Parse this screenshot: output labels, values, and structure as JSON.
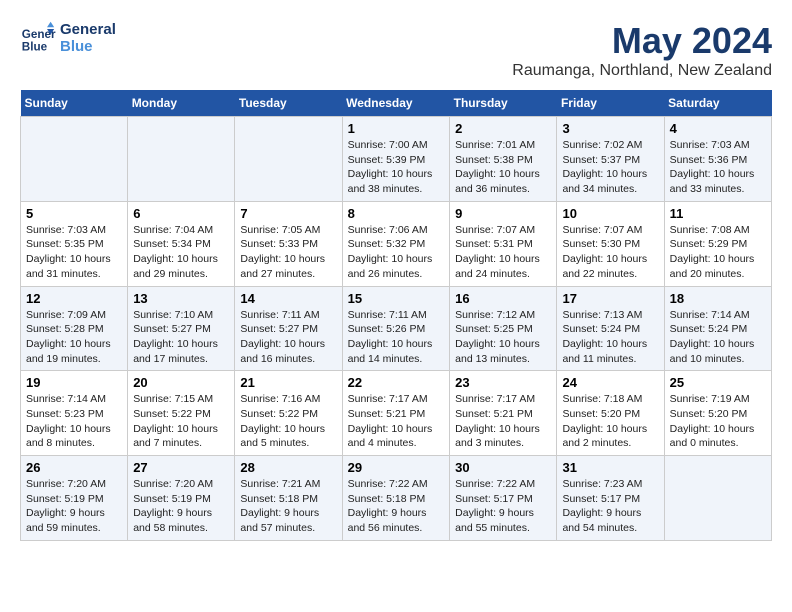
{
  "header": {
    "logo_line1": "General",
    "logo_line2": "Blue",
    "title": "May 2024",
    "subtitle": "Raumanga, Northland, New Zealand"
  },
  "days_of_week": [
    "Sunday",
    "Monday",
    "Tuesday",
    "Wednesday",
    "Thursday",
    "Friday",
    "Saturday"
  ],
  "weeks": [
    {
      "row_class": "alt-row",
      "days": [
        {
          "number": "",
          "info": ""
        },
        {
          "number": "",
          "info": ""
        },
        {
          "number": "",
          "info": ""
        },
        {
          "number": "1",
          "info": "Sunrise: 7:00 AM\nSunset: 5:39 PM\nDaylight: 10 hours\nand 38 minutes."
        },
        {
          "number": "2",
          "info": "Sunrise: 7:01 AM\nSunset: 5:38 PM\nDaylight: 10 hours\nand 36 minutes."
        },
        {
          "number": "3",
          "info": "Sunrise: 7:02 AM\nSunset: 5:37 PM\nDaylight: 10 hours\nand 34 minutes."
        },
        {
          "number": "4",
          "info": "Sunrise: 7:03 AM\nSunset: 5:36 PM\nDaylight: 10 hours\nand 33 minutes."
        }
      ]
    },
    {
      "row_class": "",
      "days": [
        {
          "number": "5",
          "info": "Sunrise: 7:03 AM\nSunset: 5:35 PM\nDaylight: 10 hours\nand 31 minutes."
        },
        {
          "number": "6",
          "info": "Sunrise: 7:04 AM\nSunset: 5:34 PM\nDaylight: 10 hours\nand 29 minutes."
        },
        {
          "number": "7",
          "info": "Sunrise: 7:05 AM\nSunset: 5:33 PM\nDaylight: 10 hours\nand 27 minutes."
        },
        {
          "number": "8",
          "info": "Sunrise: 7:06 AM\nSunset: 5:32 PM\nDaylight: 10 hours\nand 26 minutes."
        },
        {
          "number": "9",
          "info": "Sunrise: 7:07 AM\nSunset: 5:31 PM\nDaylight: 10 hours\nand 24 minutes."
        },
        {
          "number": "10",
          "info": "Sunrise: 7:07 AM\nSunset: 5:30 PM\nDaylight: 10 hours\nand 22 minutes."
        },
        {
          "number": "11",
          "info": "Sunrise: 7:08 AM\nSunset: 5:29 PM\nDaylight: 10 hours\nand 20 minutes."
        }
      ]
    },
    {
      "row_class": "alt-row",
      "days": [
        {
          "number": "12",
          "info": "Sunrise: 7:09 AM\nSunset: 5:28 PM\nDaylight: 10 hours\nand 19 minutes."
        },
        {
          "number": "13",
          "info": "Sunrise: 7:10 AM\nSunset: 5:27 PM\nDaylight: 10 hours\nand 17 minutes."
        },
        {
          "number": "14",
          "info": "Sunrise: 7:11 AM\nSunset: 5:27 PM\nDaylight: 10 hours\nand 16 minutes."
        },
        {
          "number": "15",
          "info": "Sunrise: 7:11 AM\nSunset: 5:26 PM\nDaylight: 10 hours\nand 14 minutes."
        },
        {
          "number": "16",
          "info": "Sunrise: 7:12 AM\nSunset: 5:25 PM\nDaylight: 10 hours\nand 13 minutes."
        },
        {
          "number": "17",
          "info": "Sunrise: 7:13 AM\nSunset: 5:24 PM\nDaylight: 10 hours\nand 11 minutes."
        },
        {
          "number": "18",
          "info": "Sunrise: 7:14 AM\nSunset: 5:24 PM\nDaylight: 10 hours\nand 10 minutes."
        }
      ]
    },
    {
      "row_class": "",
      "days": [
        {
          "number": "19",
          "info": "Sunrise: 7:14 AM\nSunset: 5:23 PM\nDaylight: 10 hours\nand 8 minutes."
        },
        {
          "number": "20",
          "info": "Sunrise: 7:15 AM\nSunset: 5:22 PM\nDaylight: 10 hours\nand 7 minutes."
        },
        {
          "number": "21",
          "info": "Sunrise: 7:16 AM\nSunset: 5:22 PM\nDaylight: 10 hours\nand 5 minutes."
        },
        {
          "number": "22",
          "info": "Sunrise: 7:17 AM\nSunset: 5:21 PM\nDaylight: 10 hours\nand 4 minutes."
        },
        {
          "number": "23",
          "info": "Sunrise: 7:17 AM\nSunset: 5:21 PM\nDaylight: 10 hours\nand 3 minutes."
        },
        {
          "number": "24",
          "info": "Sunrise: 7:18 AM\nSunset: 5:20 PM\nDaylight: 10 hours\nand 2 minutes."
        },
        {
          "number": "25",
          "info": "Sunrise: 7:19 AM\nSunset: 5:20 PM\nDaylight: 10 hours\nand 0 minutes."
        }
      ]
    },
    {
      "row_class": "alt-row",
      "days": [
        {
          "number": "26",
          "info": "Sunrise: 7:20 AM\nSunset: 5:19 PM\nDaylight: 9 hours\nand 59 minutes."
        },
        {
          "number": "27",
          "info": "Sunrise: 7:20 AM\nSunset: 5:19 PM\nDaylight: 9 hours\nand 58 minutes."
        },
        {
          "number": "28",
          "info": "Sunrise: 7:21 AM\nSunset: 5:18 PM\nDaylight: 9 hours\nand 57 minutes."
        },
        {
          "number": "29",
          "info": "Sunrise: 7:22 AM\nSunset: 5:18 PM\nDaylight: 9 hours\nand 56 minutes."
        },
        {
          "number": "30",
          "info": "Sunrise: 7:22 AM\nSunset: 5:17 PM\nDaylight: 9 hours\nand 55 minutes."
        },
        {
          "number": "31",
          "info": "Sunrise: 7:23 AM\nSunset: 5:17 PM\nDaylight: 9 hours\nand 54 minutes."
        },
        {
          "number": "",
          "info": ""
        }
      ]
    }
  ]
}
